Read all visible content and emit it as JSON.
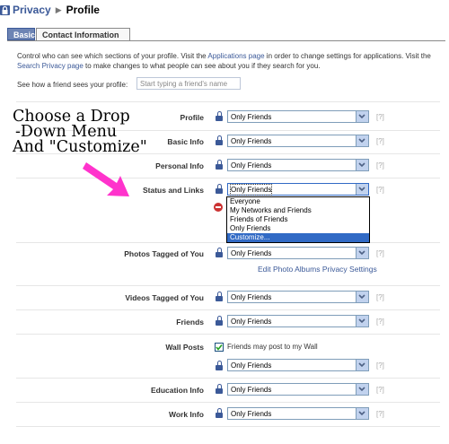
{
  "breadcrumb": {
    "root": "Privacy",
    "separator": "▶",
    "current": "Profile"
  },
  "tabs": [
    {
      "label": "Basic",
      "active": true
    },
    {
      "label": "Contact Information",
      "active": false
    }
  ],
  "intro": {
    "part1": "Control who can see which sections of your profile. Visit the ",
    "link1": "Applications page",
    "part2": " in order to change settings for applications. Visit the ",
    "link2": "Search Privacy page",
    "part3": " to make changes to what people can see about you if they search for you."
  },
  "preview": {
    "label": "See how a friend sees your profile:",
    "placeholder": "Start typing a friend's name"
  },
  "annotation": {
    "line1": "Choose a Drop",
    "line2": "-Down Menu",
    "line3": "And \"Customize\""
  },
  "rows": [
    {
      "label": "Profile",
      "value": "Only Friends"
    },
    {
      "label": "Basic Info",
      "value": "Only Friends"
    },
    {
      "label": "Personal Info",
      "value": "Only Friends"
    },
    {
      "label": "Status and Links",
      "value": "Only Friends"
    },
    {
      "label": "Photos Tagged of You",
      "value": "Only Friends",
      "link": "Edit Photo Albums Privacy Settings"
    },
    {
      "label": "Videos Tagged of You",
      "value": "Only Friends"
    },
    {
      "label": "Friends",
      "value": "Only Friends"
    },
    {
      "label": "Wall Posts",
      "checkbox_label": "Friends may post to my Wall",
      "checked": true,
      "value": "Only Friends"
    },
    {
      "label": "Education Info",
      "value": "Only Friends"
    },
    {
      "label": "Work Info",
      "value": "Only Friends"
    }
  ],
  "help_label": "[?]",
  "dropdown_options": [
    "Everyone",
    "My Networks and Friends",
    "Friends of Friends",
    "Only Friends",
    "Customize..."
  ],
  "dropdown_selected_index": 4,
  "edge_char": "s",
  "colors": {
    "brand": "#3b5998",
    "highlight": "#316ac5",
    "arrow": "#ff33cc"
  }
}
